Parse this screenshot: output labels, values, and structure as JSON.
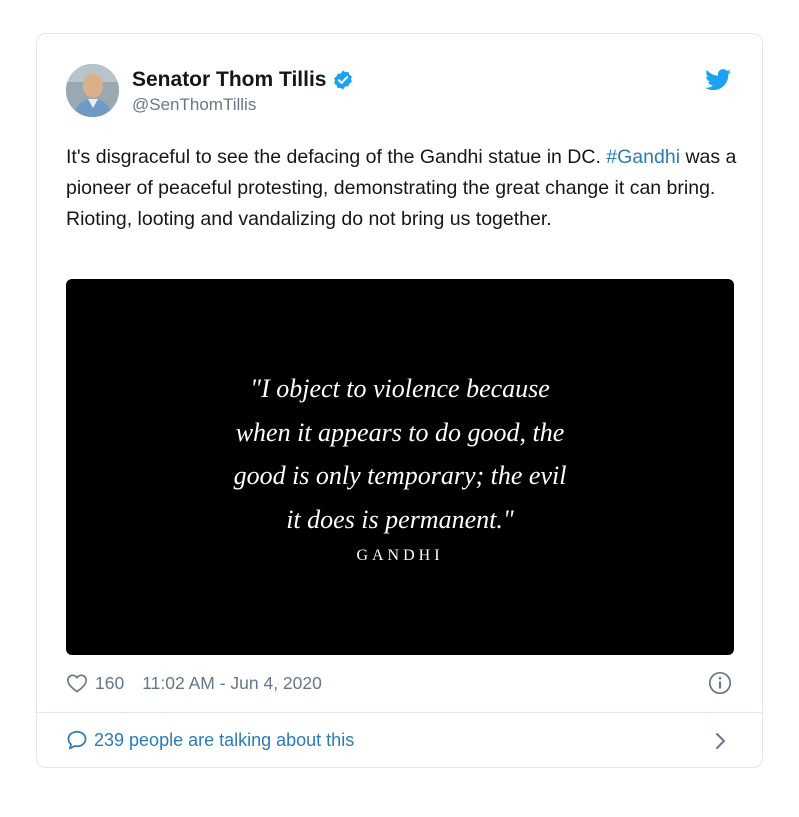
{
  "tweet": {
    "author_name": "Senator Thom Tillis",
    "handle": "@SenThomTillis",
    "text_before": "It's disgraceful to see the defacing of the Gandhi statue in DC. ",
    "hashtag": "#Gandhi",
    "text_after": " was a pioneer of peaceful protesting, demonstrating the great change it can bring. Rioting, looting and vandalizing do not bring us together.",
    "likes": "160",
    "timestamp": "11:02 AM - Jun 4, 2020",
    "talking": "239 people are talking about this"
  },
  "media": {
    "quote_lines": [
      "\"I object to violence because",
      "when it appears to do good, the",
      "good is only temporary; the evil",
      "it does is permanent.\""
    ],
    "author": "GANDHI"
  },
  "colors": {
    "link": "#2b7bb9",
    "verified": "#1da1f2",
    "text": "#14171a",
    "muted": "#657786",
    "border": "#e1e8ed"
  },
  "icons": {
    "brand": "twitter-bird-icon",
    "verified": "verified-badge-icon",
    "like": "heart-icon",
    "info": "info-icon",
    "reply": "speech-bubble-icon",
    "more": "chevron-right-icon"
  }
}
